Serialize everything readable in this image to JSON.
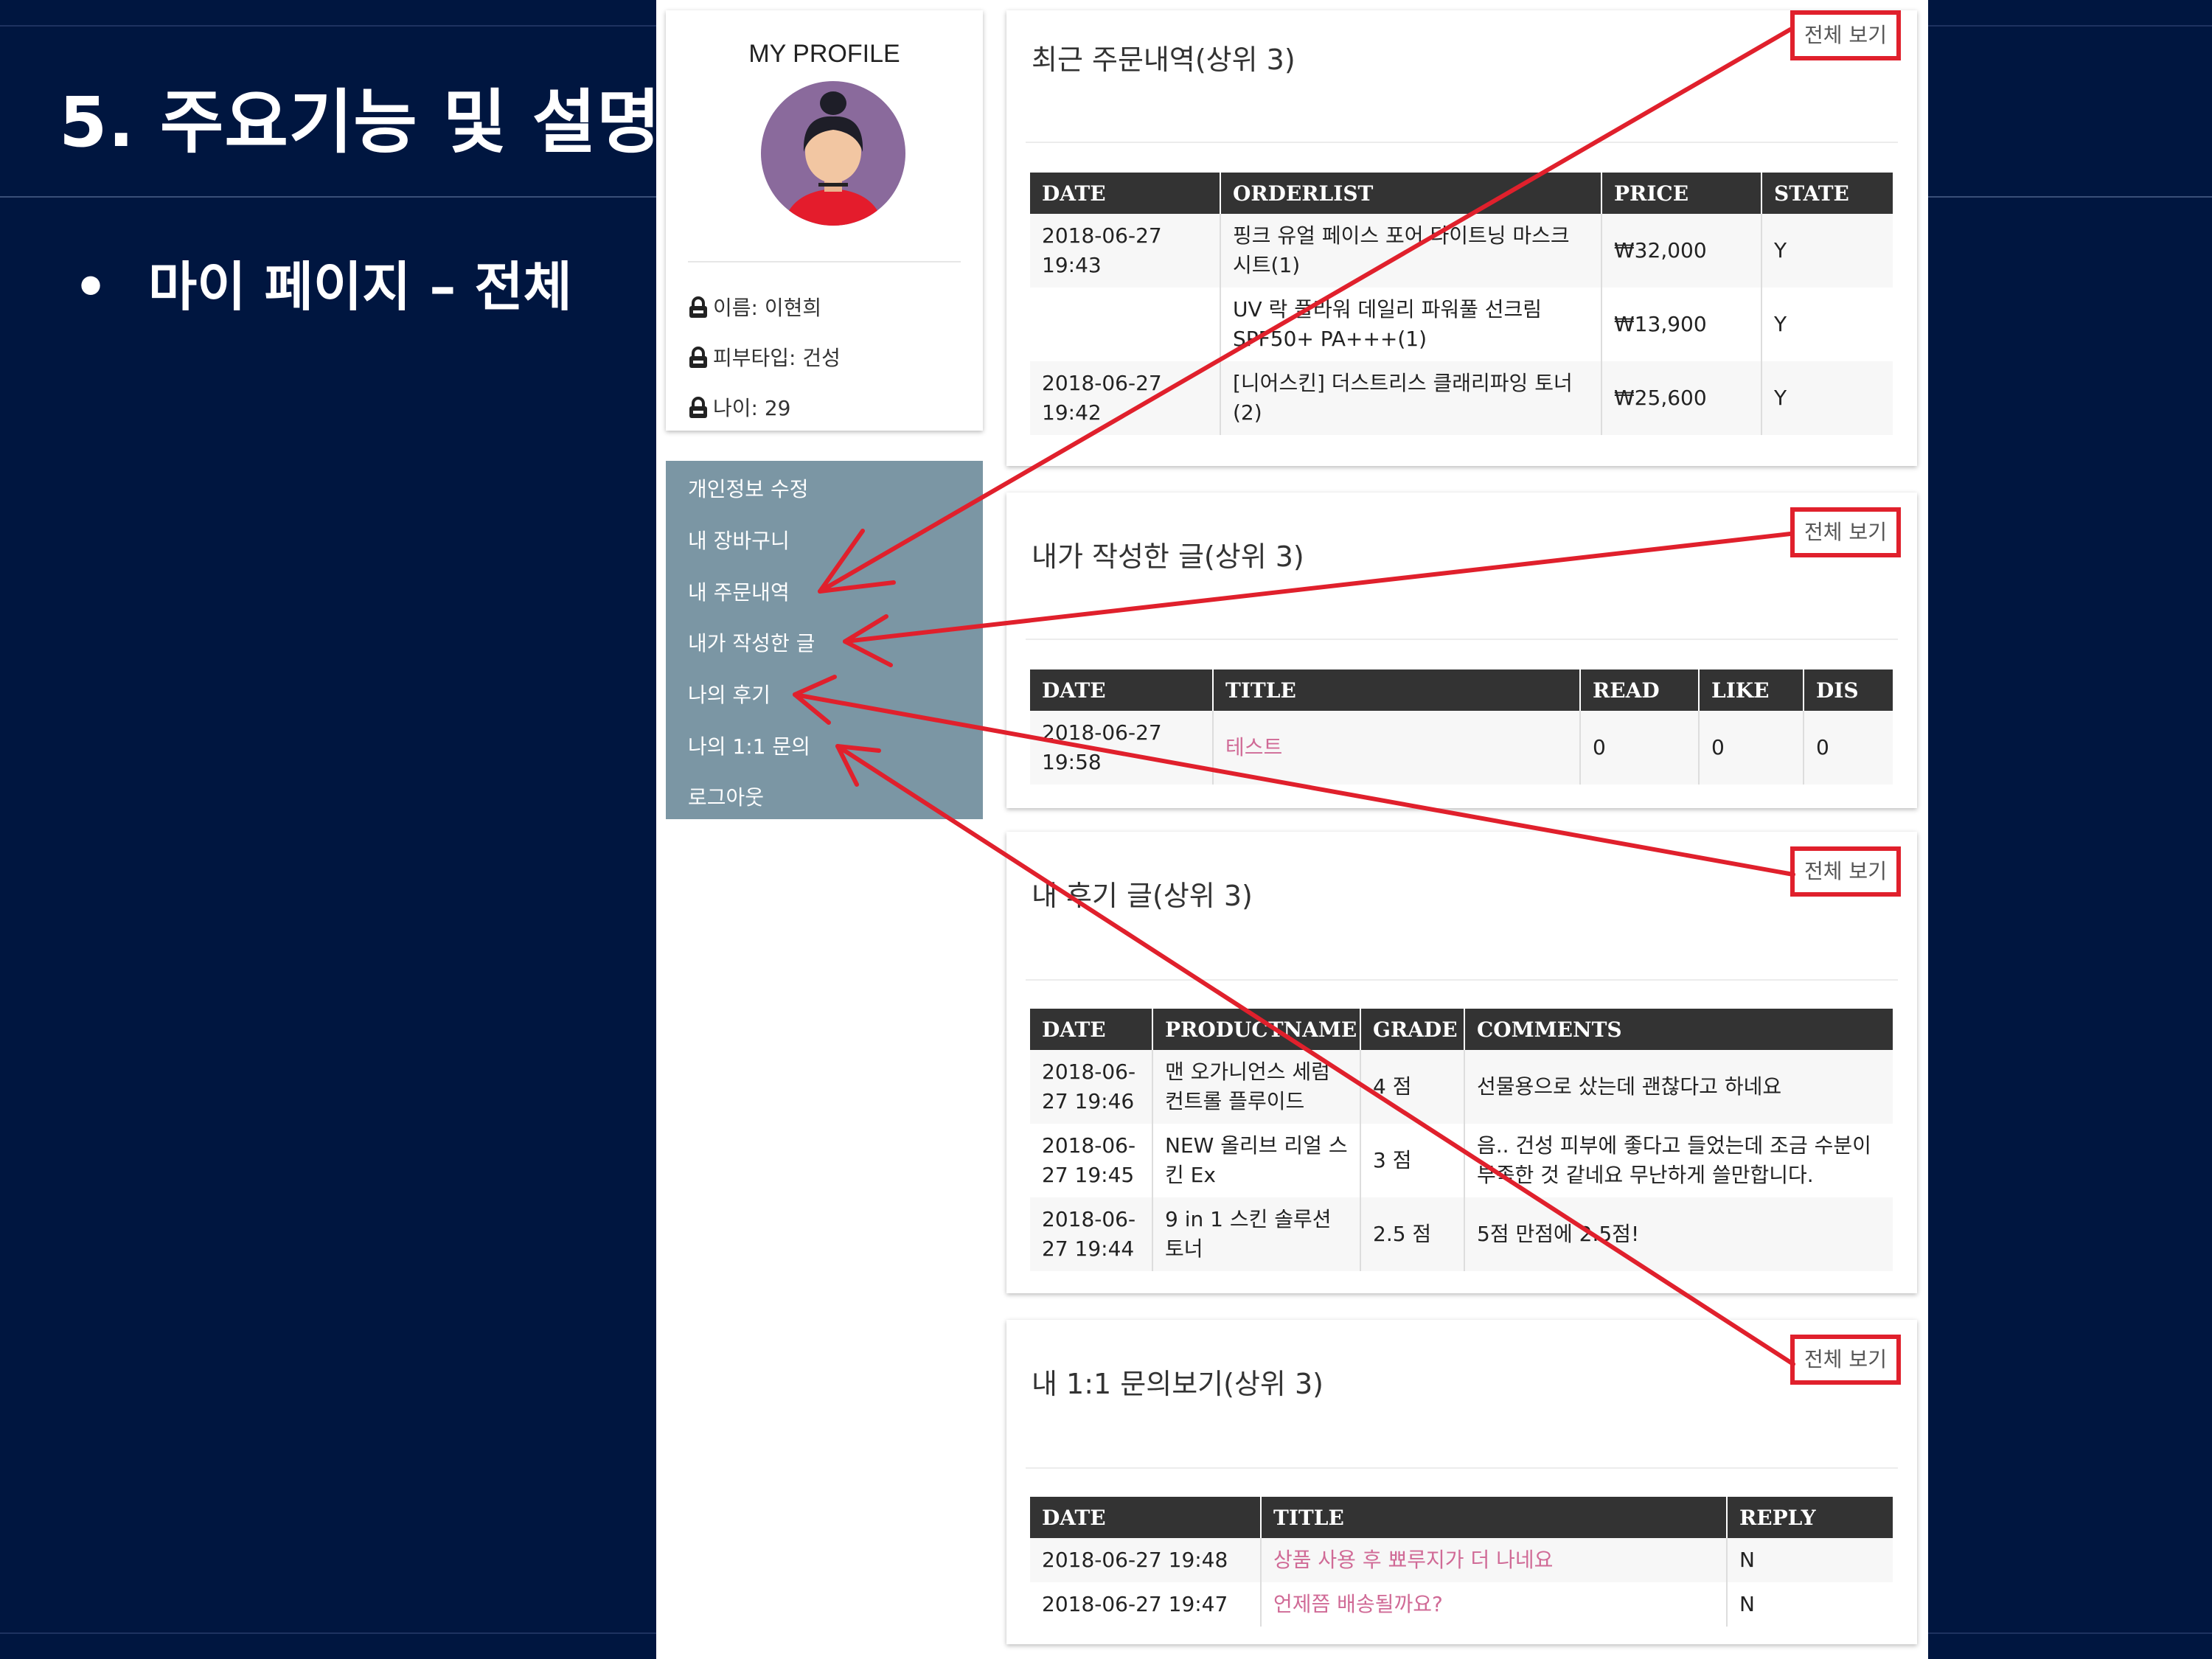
{
  "slide": {
    "title": "5. 주요기능 및 설명",
    "bullet_symbol": "•",
    "bullet_text": "마이 페이지 – 전체"
  },
  "profile": {
    "title": "MY PROFILE",
    "avatar_icon": "woman-avatar-icon",
    "fields": [
      {
        "icon": "lock-icon",
        "text": "이름: 이현희"
      },
      {
        "icon": "lock-icon",
        "text": "피부타입: 건성"
      },
      {
        "icon": "lock-icon",
        "text": "나이: 29"
      }
    ]
  },
  "menu": {
    "items": [
      "개인정보 수정",
      "내 장바구니",
      "내 주문내역",
      "내가 작성한 글",
      "나의 후기",
      "나의 1:1 문의",
      "로그아웃"
    ]
  },
  "view_all_label": "전체 보기",
  "orders": {
    "title": "최근 주문내역(상위 3)",
    "headers": [
      "DATE",
      "ORDERLIST",
      "PRICE",
      "STATE"
    ],
    "rows": [
      {
        "date": "2018-06-27 19:43",
        "item": "핑크 유얼 페이스 포어 타이트닝 마스크 시트(1)",
        "price": "₩32,000",
        "state": "Y"
      },
      {
        "date": "",
        "item": "UV 락 플라워 데일리 파워풀 선크림 SPF50+ PA+++(1)",
        "price": "₩13,900",
        "state": "Y"
      },
      {
        "date": "2018-06-27 19:42",
        "item": "[니어스킨] 더스트리스 클래리파잉 토너(2)",
        "price": "₩25,600",
        "state": "Y"
      }
    ]
  },
  "posts": {
    "title": "내가 작성한 글(상위 3)",
    "headers": [
      "DATE",
      "TITLE",
      "READ",
      "LIKE",
      "DIS"
    ],
    "rows": [
      {
        "date": "2018-06-27 19:58",
        "title": "테스트",
        "read": "0",
        "like": "0",
        "dis": "0"
      }
    ]
  },
  "reviews": {
    "title": "내 후기 글(상위 3)",
    "headers": [
      "DATE",
      "PRODUCTNAME",
      "GRADE",
      "COMMENTS"
    ],
    "rows": [
      {
        "date": "2018-06-27 19:46",
        "product": "맨 오가니언스 세럼 컨트롤 플루이드",
        "grade": "4 점",
        "comment": "선물용으로 샀는데 괜찮다고 하네요"
      },
      {
        "date": "2018-06-27 19:45",
        "product": "NEW 올리브 리얼 스킨 Ex",
        "grade": "3 점",
        "comment": "음.. 건성 피부에 좋다고 들었는데 조금 수분이 부족한 것 같네요 무난하게 쓸만합니다."
      },
      {
        "date": "2018-06-27 19:44",
        "product": "9 in 1 스킨 솔루션 토너",
        "grade": "2.5 점",
        "comment": "5점 만점에 2.5점!"
      }
    ]
  },
  "inquiries": {
    "title": "내 1:1 문의보기(상위 3)",
    "headers": [
      "DATE",
      "TITLE",
      "REPLY"
    ],
    "rows": [
      {
        "date": "2018-06-27 19:48",
        "title": "상품 사용 후 뾰루지가 더 나네요",
        "reply": "N"
      },
      {
        "date": "2018-06-27 19:47",
        "title": "언제쯤 배송될까요?",
        "reply": "N"
      }
    ]
  },
  "colors": {
    "slide_background": "#001640",
    "menu_background": "#7b96a4",
    "annotation_red": "#e0202c",
    "link_pink": "#d06a96",
    "table_header": "#333333"
  }
}
